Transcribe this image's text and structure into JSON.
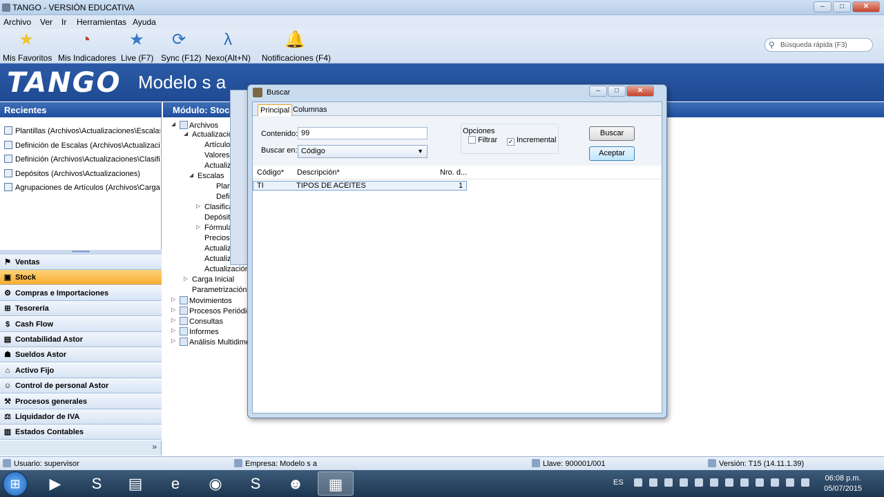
{
  "window": {
    "title": "TANGO - VERSIÓN EDUCATIVA",
    "min": "–",
    "max": "□",
    "close": "✕"
  },
  "menu": [
    "Archivo",
    "Ver",
    "Ir",
    "Herramientas",
    "Ayuda"
  ],
  "toolbar": [
    {
      "label": "Mis Favoritos",
      "icon": "star-icon",
      "glyph": "★",
      "color": "#f2c230"
    },
    {
      "label": "Mis Indicadores",
      "icon": "gauge-icon",
      "glyph": "◔",
      "color": "#c0392b"
    },
    {
      "label": "Live (F7)",
      "icon": "live-star-icon",
      "glyph": "★",
      "color": "#3a78c8"
    },
    {
      "label": "Sync (F12)",
      "icon": "sync-icon",
      "glyph": "⟳",
      "color": "#2a6fb8"
    },
    {
      "label": "Nexo(Alt+N)",
      "icon": "nexo-icon",
      "glyph": "λ",
      "color": "#2a6fb8"
    },
    {
      "label": "Notificaciones (F4)",
      "icon": "bell-icon",
      "glyph": "🔔",
      "color": "#444"
    }
  ],
  "quick_search": {
    "placeholder": "Búsqueda rápida (F3)"
  },
  "banner": {
    "logo": "TANGO",
    "title": "Modelo s a"
  },
  "recientes": {
    "title": "Recientes",
    "items": [
      "Plantillas (Archivos\\Actualizaciones\\Escalas)",
      "Definición de Escalas (Archivos\\Actualizacio...",
      "Definición (Archivos\\Actualizaciones\\Clasific...",
      "Depósitos (Archivos\\Actualizaciones)",
      "Agrupaciones de Artículos (Archivos\\Carga ..."
    ]
  },
  "modules": [
    {
      "label": "Ventas",
      "active": false
    },
    {
      "label": "Stock",
      "active": true
    },
    {
      "label": "Compras e Importaciones",
      "active": false
    },
    {
      "label": "Tesorería",
      "active": false
    },
    {
      "label": "Cash Flow",
      "active": false
    },
    {
      "label": "Contabilidad Astor",
      "active": false
    },
    {
      "label": "Sueldos Astor",
      "active": false
    },
    {
      "label": "Activo Fijo",
      "active": false
    },
    {
      "label": "Control de personal Astor",
      "active": false
    },
    {
      "label": "Procesos generales",
      "active": false
    },
    {
      "label": "Liquidador de IVA",
      "active": false
    },
    {
      "label": "Estados Contables",
      "active": false
    }
  ],
  "module_footer": "»",
  "module_header": "Módulo: Stock",
  "tree": [
    {
      "label": "Archivos",
      "expander": "◢"
    },
    {
      "label": "Actualizaciones",
      "expander": "◢"
    },
    {
      "label": "Artículos",
      "expander": ""
    },
    {
      "label": "Valores",
      "expander": ""
    },
    {
      "label": "Actualiz",
      "expander": ""
    },
    {
      "label": "Escalas",
      "expander": "◢"
    },
    {
      "label": "Plantillas",
      "expander": ""
    },
    {
      "label": "Definición",
      "expander": ""
    },
    {
      "label": "Clasificación",
      "expander": "▷"
    },
    {
      "label": "Depósitos",
      "expander": ""
    },
    {
      "label": "Fórmulas",
      "expander": "▷"
    },
    {
      "label": "Precios",
      "expander": ""
    },
    {
      "label": "Actualiz",
      "expander": ""
    },
    {
      "label": "Actualiz",
      "expander": ""
    },
    {
      "label": "Actualización",
      "expander": ""
    },
    {
      "label": "Carga Inicial",
      "expander": "▷"
    },
    {
      "label": "Parametrización c",
      "expander": ""
    },
    {
      "label": "Movimientos",
      "expander": "▷"
    },
    {
      "label": "Procesos Periódicos",
      "expander": "▷"
    },
    {
      "label": "Consultas",
      "expander": "▷"
    },
    {
      "label": "Informes",
      "expander": "▷"
    },
    {
      "label": "Análisis Multidimensional",
      "expander": "▷"
    }
  ],
  "dialog": {
    "title": "Buscar",
    "tabs": [
      "Principal",
      "Columnas"
    ],
    "contenido_label": "Contenido:",
    "contenido_value": "99",
    "buscar_en_label": "Buscar en:",
    "buscar_en_value": "Código",
    "opciones_label": "Opciones",
    "filtrar_label": "Filtrar",
    "filtrar_checked": false,
    "incremental_label": "Incremental",
    "incremental_checked": true,
    "buscar_button": "Buscar",
    "aceptar_button": "Aceptar",
    "columns": [
      "Código*",
      "Descripción*",
      "Nro. d..."
    ],
    "rows": [
      {
        "codigo": "TI",
        "descripcion": "TIPOS DE ACEITES",
        "nro": "1"
      }
    ]
  },
  "status": {
    "usuario": "Usuario: supervisor",
    "empresa": "Empresa: Modelo s a",
    "llave": "Llave: 900001/001",
    "version": "Versión: T15 (14.11.1.39)"
  },
  "taskbar": {
    "start": "⊞",
    "apps": [
      {
        "name": "media-player-icon",
        "glyph": "▶",
        "active": false
      },
      {
        "name": "app-s-icon",
        "glyph": "S",
        "active": false
      },
      {
        "name": "folder-icon",
        "glyph": "▤",
        "active": false
      },
      {
        "name": "ie-icon",
        "glyph": "e",
        "active": false
      },
      {
        "name": "chrome-icon",
        "glyph": "◉",
        "active": false
      },
      {
        "name": "skype-icon",
        "glyph": "S",
        "active": false
      },
      {
        "name": "user-app-icon",
        "glyph": "☻",
        "active": false
      },
      {
        "name": "tango-app-icon",
        "glyph": "▦",
        "active": true
      }
    ],
    "lang": "ES",
    "time": "06:08 p.m.",
    "date": "05/07/2015"
  }
}
